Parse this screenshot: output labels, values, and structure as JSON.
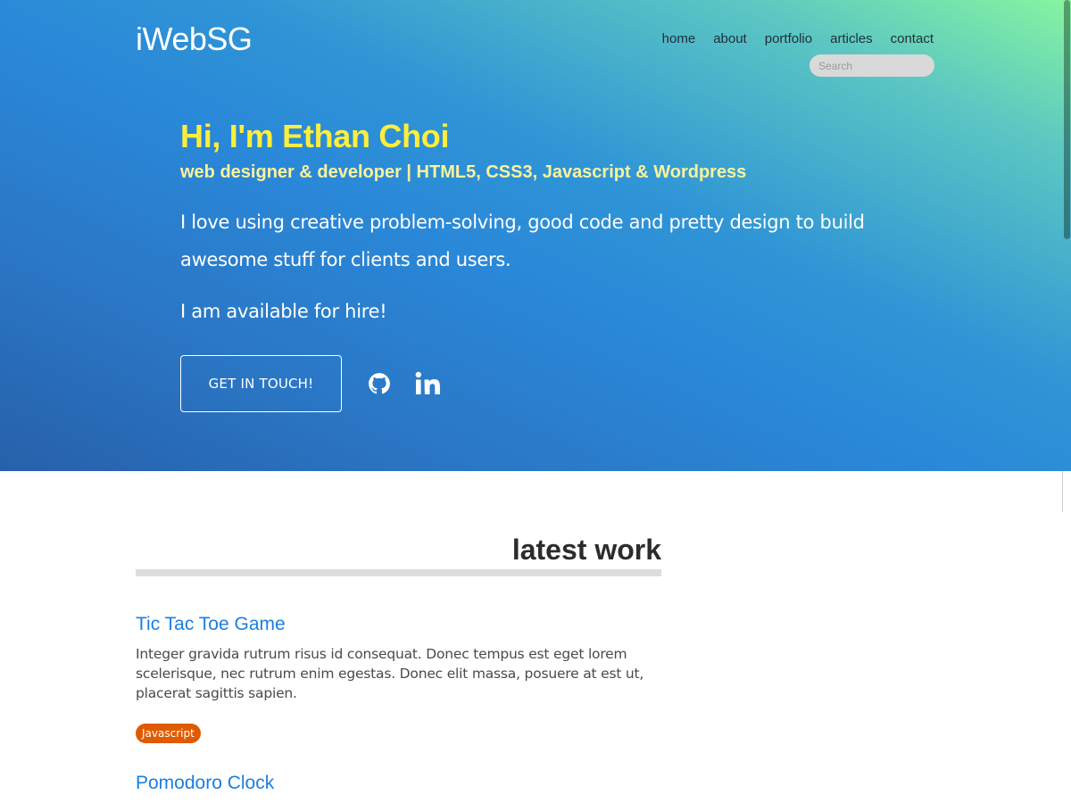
{
  "site": {
    "logo": "iWebSG"
  },
  "nav": {
    "items": [
      {
        "label": "home"
      },
      {
        "label": "about"
      },
      {
        "label": "portfolio"
      },
      {
        "label": "articles"
      },
      {
        "label": "contact"
      }
    ],
    "search_placeholder": "Search"
  },
  "hero": {
    "greeting": "Hi, I'm Ethan Choi",
    "subtitle": "web designer & developer | HTML5, CSS3, Javascript & Wordpress",
    "intro": "I love using creative problem-solving, good code and pretty design to build awesome stuff for clients and users.",
    "availability": "I am available for hire!",
    "cta_label": "GET IN TOUCH!",
    "social": [
      {
        "icon": "github-icon"
      },
      {
        "icon": "linkedin-icon"
      }
    ]
  },
  "latest_work": {
    "title": "latest work",
    "projects": [
      {
        "title": "Tic Tac Toe Game",
        "description": "Integer gravida rutrum risus id consequat. Donec tempus est eget lorem scelerisque, nec rutrum enim egestas. Donec elit massa, posuere at est ut, placerat sagittis sapien.",
        "tag": "Javascript"
      },
      {
        "title": "Pomodoro Clock"
      }
    ]
  },
  "colors": {
    "greeting": "#ffee3d",
    "subtitle": "#fdf39a",
    "link": "#1a7fe0",
    "tag": "#e05a00",
    "gradient_light": "#86f5a0",
    "gradient_mid": "#2a88d8",
    "gradient_dark": "#2760aa"
  }
}
